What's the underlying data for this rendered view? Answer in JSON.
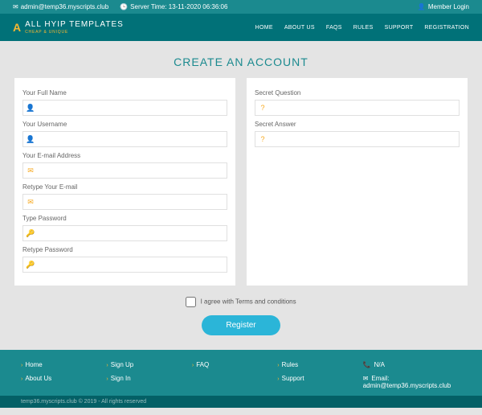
{
  "topbar": {
    "email": "admin@temp36.myscripts.club",
    "server_time_label": "Server Time: 13-11-2020 06:36:06",
    "member_login": "Member Login"
  },
  "brand": {
    "name": "ALL HYIP TEMPLATES",
    "tagline": "CHEAP & UNIQUE"
  },
  "nav": [
    "HOME",
    "ABOUT US",
    "FAQS",
    "RULES",
    "SUPPORT",
    "REGISTRATION"
  ],
  "page_title": "CREATE AN ACCOUNT",
  "fields_left": [
    {
      "label": "Your Full Name",
      "icon": "user"
    },
    {
      "label": "Your Username",
      "icon": "user"
    },
    {
      "label": "Your E-mail Address",
      "icon": "mail"
    },
    {
      "label": "Retype Your E-mail",
      "icon": "mail"
    },
    {
      "label": "Type Password",
      "icon": "key"
    },
    {
      "label": "Retype Password",
      "icon": "key"
    }
  ],
  "fields_right": [
    {
      "label": "Secret Question",
      "icon": "question"
    },
    {
      "label": "Secret Answer",
      "icon": "question"
    }
  ],
  "terms_label": "I agree with Terms and conditions",
  "register_label": "Register",
  "footer": {
    "col1": [
      "Home",
      "About Us"
    ],
    "col2": [
      "Sign Up",
      "Sign In"
    ],
    "col3": [
      "FAQ"
    ],
    "col4": [
      "Rules",
      "Support"
    ],
    "contact_phone": "N/A",
    "contact_email": "Email: admin@temp36.myscripts.club",
    "copyright": "temp36.myscripts.club © 2019 - All rights reserved"
  }
}
